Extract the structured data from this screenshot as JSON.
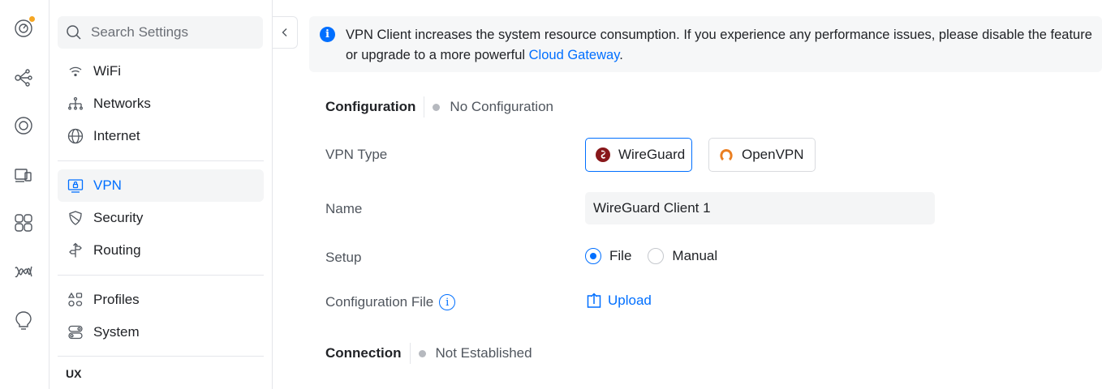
{
  "rail": {
    "items": [
      {
        "icon": "dashboard-icon"
      },
      {
        "icon": "topology-icon"
      },
      {
        "icon": "unifi-devices-icon"
      },
      {
        "icon": "client-devices-icon"
      },
      {
        "icon": "ports-icon"
      },
      {
        "icon": "radio-manager-icon"
      },
      {
        "icon": "insights-icon"
      }
    ],
    "badge_color": "#f5a623"
  },
  "sidebar": {
    "search_placeholder": "Search Settings",
    "items": [
      {
        "label": "WiFi",
        "icon": "wifi-icon"
      },
      {
        "label": "Networks",
        "icon": "networks-icon"
      },
      {
        "label": "Internet",
        "icon": "globe-icon"
      },
      {
        "label": "VPN",
        "icon": "vpn-icon",
        "active": true
      },
      {
        "label": "Security",
        "icon": "shield-icon"
      },
      {
        "label": "Routing",
        "icon": "routing-icon"
      },
      {
        "label": "Profiles",
        "icon": "profiles-icon"
      },
      {
        "label": "System",
        "icon": "system-icon"
      }
    ],
    "section_label": "UX"
  },
  "banner": {
    "text_line1": "VPN Client increases the system resource consumption. If you experience any performance issues, please disable the feature",
    "text_line2_prefix": "or upgrade to a more powerful ",
    "link_text": "Cloud Gateway",
    "text_line2_suffix": "."
  },
  "configuration": {
    "label": "Configuration",
    "status": "No Configuration"
  },
  "form": {
    "vpn_type_label": "VPN Type",
    "vpn_types": [
      {
        "label": "WireGuard",
        "selected": true
      },
      {
        "label": "OpenVPN",
        "selected": false
      }
    ],
    "name_label": "Name",
    "name_value": "WireGuard Client 1",
    "setup_label": "Setup",
    "setup_options": [
      {
        "label": "File",
        "checked": true
      },
      {
        "label": "Manual",
        "checked": false
      }
    ],
    "config_file_label": "Configuration File",
    "upload_label": "Upload"
  },
  "connection": {
    "label": "Connection",
    "status": "Not Established"
  },
  "colors": {
    "accent": "#006fff",
    "wireguard": "#88171a",
    "openvpn": "#ea7e20"
  }
}
